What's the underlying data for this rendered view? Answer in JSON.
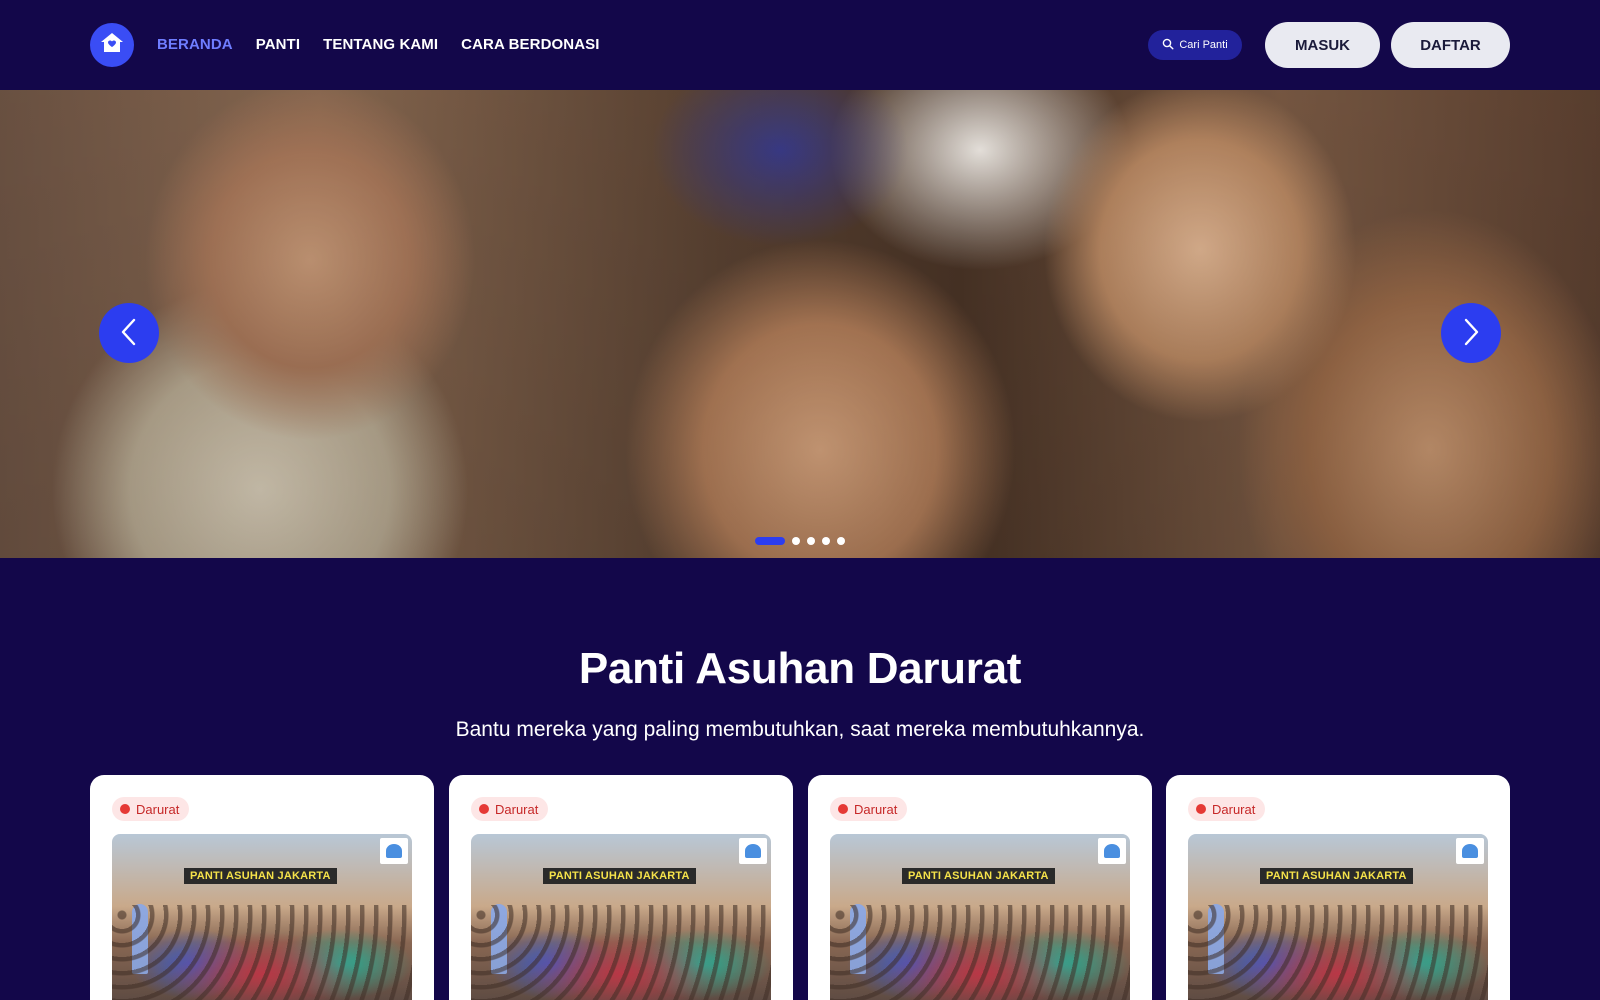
{
  "nav": {
    "logo_icon": "home-icon",
    "links": [
      {
        "label": "BERANDA",
        "active": true
      },
      {
        "label": "PANTI",
        "active": false
      },
      {
        "label": "TENTANG KAMI",
        "active": false
      },
      {
        "label": "CARA BERDONASI",
        "active": false
      }
    ],
    "search_label": "Cari Panti",
    "login_label": "MASUK",
    "register_label": "DAFTAR"
  },
  "hero": {
    "prev_icon": "chevron-left-icon",
    "next_icon": "chevron-right-icon",
    "slide_count": 5,
    "active_slide": 0
  },
  "section": {
    "title": "Panti Asuhan Darurat",
    "subtitle": "Bantu mereka yang paling membutuhkan, saat mereka membutuhkannya."
  },
  "cards": [
    {
      "badge": "Darurat",
      "photo_banner": "PANTI ASUHAN JAKARTA"
    },
    {
      "badge": "Darurat",
      "photo_banner": "PANTI ASUHAN JAKARTA"
    },
    {
      "badge": "Darurat",
      "photo_banner": "PANTI ASUHAN JAKARTA"
    },
    {
      "badge": "Darurat",
      "photo_banner": "PANTI ASUHAN JAKARTA"
    }
  ],
  "colors": {
    "background": "#13074a",
    "accent": "#2c3df0",
    "active_link": "#6f7dff",
    "badge_red": "#e53935"
  }
}
